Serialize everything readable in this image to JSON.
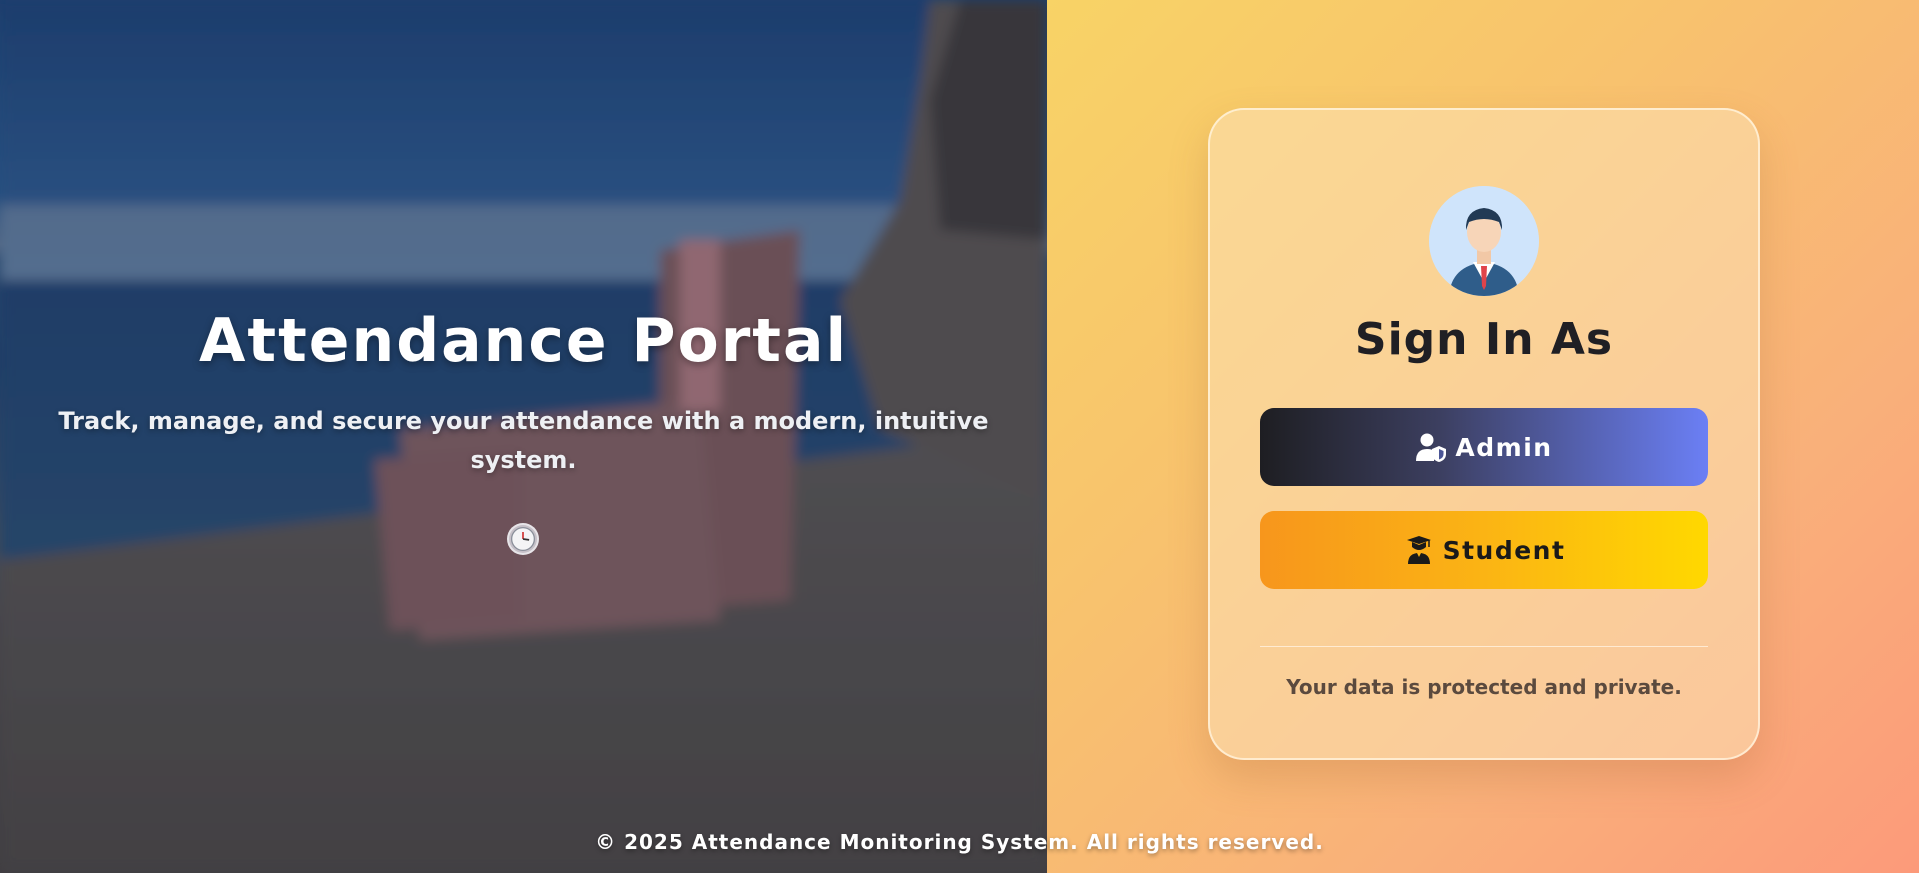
{
  "hero": {
    "title": "Attendance Portal",
    "subtitle": "Track, manage, and secure your attendance with a modern, intuitive system.",
    "icon": "clock-icon"
  },
  "signin": {
    "avatar_icon": "user-avatar-icon",
    "title": "Sign In As",
    "admin_label": "Admin",
    "admin_icon": "user-shield-icon",
    "student_label": "Student",
    "student_icon": "graduate-icon",
    "note": "Your data is protected and private."
  },
  "footer": {
    "text": "© 2025 Attendance Monitoring System. All rights reserved."
  },
  "colors": {
    "admin_gradient": [
      "#1e1e22",
      "#6b7ff5"
    ],
    "student_gradient": [
      "#f7961c",
      "#ffd800"
    ],
    "panel_gradient": [
      "#f8d366",
      "#fc9a7a"
    ]
  }
}
